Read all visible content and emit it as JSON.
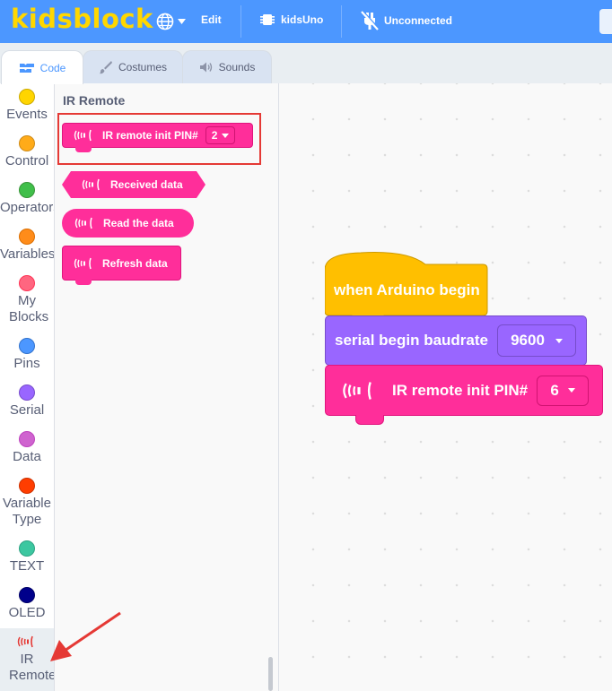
{
  "app": {
    "logo": "kidsblock"
  },
  "menu": {
    "edit": "Edit",
    "board": "kidsUno",
    "connection": "Unconnected"
  },
  "tabs": [
    {
      "label": "Code",
      "active": true
    },
    {
      "label": "Costumes"
    },
    {
      "label": "Sounds"
    }
  ],
  "categories": [
    {
      "label": "Events",
      "color": "#ffd500"
    },
    {
      "label": "Control",
      "color": "#ffab19"
    },
    {
      "label": "Operators",
      "color": "#40bf4a"
    },
    {
      "label": "Variables",
      "color": "#ff8c1a"
    },
    {
      "label": "My Blocks",
      "color": "#ff6680"
    },
    {
      "label": "Pins",
      "color": "#4c97ff"
    },
    {
      "label": "Serial",
      "color": "#9966ff"
    },
    {
      "label": "Data",
      "color": "#cf63cf"
    },
    {
      "label": "Variable Type",
      "color": "#ff3d00"
    },
    {
      "label": "TEXT",
      "color": "#3cc7a0"
    },
    {
      "label": "OLED",
      "color": "#00008b"
    },
    {
      "label": "IR Remote",
      "icon": "ir-remote-icon",
      "selected": true
    }
  ],
  "palette": {
    "title": "IR Remote",
    "blocks": {
      "init_label": "IR remote init PIN#",
      "init_value": "2",
      "received": "Received data",
      "read": "Read the data",
      "refresh": "Refresh data"
    }
  },
  "workspace": {
    "hat_label": "when Arduino begin",
    "serial_label": "serial begin baudrate",
    "serial_value": "9600",
    "ir_label": "IR remote init PIN#",
    "ir_value": "6"
  },
  "colors": {
    "topbar": "#4c97ff",
    "logo": "#ffd700",
    "ir_block": "#ff2e9a",
    "serial_block": "#9966ff",
    "event_block": "#ffbf00",
    "highlight": "#e53935"
  }
}
